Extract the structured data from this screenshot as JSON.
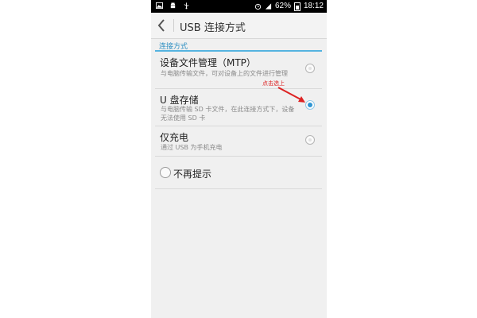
{
  "statusbar": {
    "battery_percent": "62%",
    "time": "18:12",
    "left_icons": [
      "image-icon",
      "android-debug-icon",
      "usb-icon"
    ],
    "right_icons": [
      "alarm-icon",
      "signal-icon",
      "battery-icon"
    ]
  },
  "appbar": {
    "title": "USB 连接方式",
    "back_icon": "chevron-left-icon"
  },
  "section": {
    "header": "连接方式"
  },
  "options": [
    {
      "title": "设备文件管理（MTP）",
      "subtitle": "与电脑传输文件，可对设备上的文件进行管理",
      "selected": false
    },
    {
      "title": "U 盘存储",
      "subtitle": "与电脑传输 SD 卡文件，在此连接方式下，设备无法使用 SD 卡",
      "selected": true
    },
    {
      "title": "仅充电",
      "subtitle": "通过 USB 为手机充电",
      "selected": false
    }
  ],
  "dont_show": {
    "label": "不再提示",
    "checked": false
  },
  "annotation": {
    "text": "点击选上",
    "color": "#dd2222"
  },
  "colors": {
    "accent": "#2f95d2",
    "section_header": "#2e8fc2"
  }
}
